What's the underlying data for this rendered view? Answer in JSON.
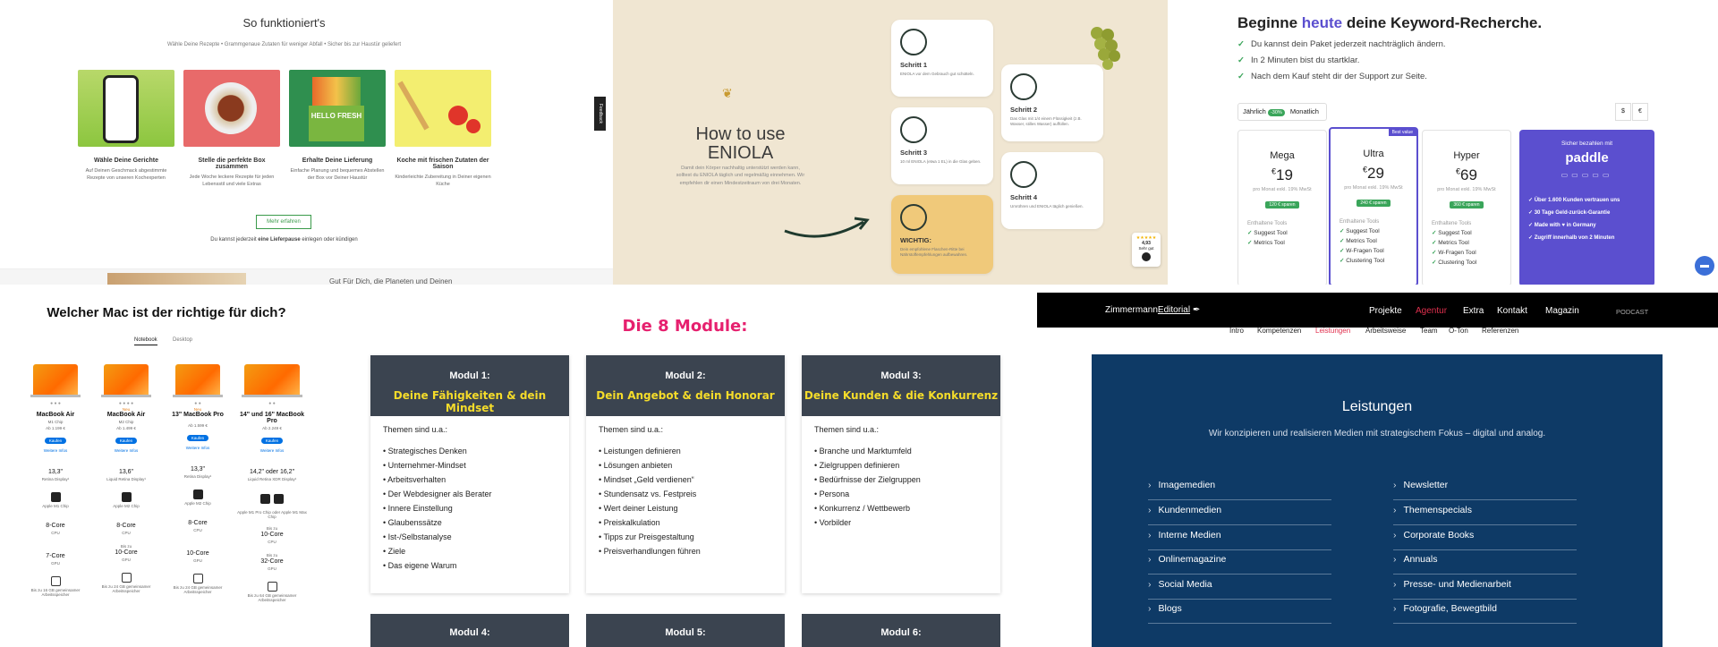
{
  "p1": {
    "title": "So funktioniert's",
    "subtitle": "Wähle Deine Rezepte • Grammgenaue Zutaten für weniger Abfall • Sicher bis zur Haustür geliefert",
    "steps": [
      {
        "title": "Wähle Deine Gerichte",
        "text": "Auf Deinen Geschmack abgestimmte Rezepte von unseren Kochexperten"
      },
      {
        "title": "Stelle die perfekte Box zusammen",
        "text": "Jede Woche leckere Rezepte für jeden Lebensstil und viele Extras"
      },
      {
        "title": "Erhalte Deine Lieferung",
        "text": "Einfache Planung und bequemes Abstellen der Box vor Deiner Haustür"
      },
      {
        "title": "Koche mit frischen Zutaten der Saison",
        "text": "Kinderleichte Zubereitung in Deiner eigenen Küche"
      }
    ],
    "hellofresh_logo": "HELLO FRESH",
    "more_button": "Mehr erfahren",
    "note_prefix": "Du kannst jederzeit ",
    "note_bold": "eine Lieferpause",
    "note_suffix": " einlegen oder kündigen",
    "feedback": "Feedback",
    "bottom_text": "Gut Für Dich, die Planeten und Deinen"
  },
  "p2": {
    "title_line1": "How to use",
    "title_line2": "ENIOLA",
    "description": "Damit dein Körper nachhaltig unterstützt werden kann, solltest du ENIOLA täglich und regelmäßig einnehmen. Wir empfehlen dir einen Mindestzeitraum von drei Monaten.",
    "steps": [
      {
        "title": "Schritt 1",
        "text": "ENIOLA vor dem Gebrauch gut schütteln."
      },
      {
        "title": "Schritt 2",
        "text": "Das Glas mit 1/4 einem Flüssigkeit (z.B. Wasser, stilles Wasser) auffüllen."
      },
      {
        "title": "Schritt 3",
        "text": "10 ml ENIOLA (etwa 1 EL) in die Glas geben."
      },
      {
        "title": "Schritt 4",
        "text": "Umrühren und ENIOLA täglich genießen."
      }
    ],
    "important_title": "WICHTIG:",
    "important_text": "Dein empfohlene Flaschen-Ritte bei Nährstoffempfehlungen aufbewahren.",
    "rating_stars": "★★★★★",
    "rating_value": "4,93",
    "rating_label": "Sehr gut"
  },
  "p3": {
    "headline_before": "Beginne ",
    "headline_accent": "heute",
    "headline_after": " deine Keyword-Recherche.",
    "accent_color": "#5b4fcf",
    "bullets": [
      "Du kannst dein Paket jederzeit nachträglich ändern.",
      "In 2 Minuten bist du startklar.",
      "Nach dem Kauf steht dir der Support zur Seite."
    ],
    "billing": {
      "yearly": "Jährlich",
      "discount": "-30%",
      "monthly": "Monatlich"
    },
    "currency": [
      "$",
      "€"
    ],
    "plans": [
      {
        "name": "Mega",
        "currency": "€",
        "price": "19",
        "note": "pro Monat exkl. 19% MwSt",
        "save": "120 € sparen",
        "tools": [
          "Suggest Tool",
          "Metrics Tool"
        ]
      },
      {
        "name": "Ultra",
        "currency": "€",
        "price": "29",
        "note": "pro Monat exkl. 19% MwSt",
        "save": "240 € sparen",
        "tools": [
          "Suggest Tool",
          "Metrics Tool",
          "W-Fragen Tool",
          "Clustering Tool"
        ],
        "badge": "Best value"
      },
      {
        "name": "Hyper",
        "currency": "€",
        "price": "69",
        "note": "pro Monat exkl. 19% MwSt",
        "save": "360 € sparen",
        "tools": [
          "Suggest Tool",
          "Metrics Tool",
          "W-Fragen Tool",
          "Clustering Tool"
        ]
      }
    ],
    "tools_label": "Enthaltene Tools",
    "paddle": {
      "label": "Sicher bezahlen mit",
      "brand": "paddle",
      "points": [
        "Über 1.600 Kunden vertrauen uns",
        "30 Tage Geld-zurück-Garantie",
        "Made with ♥ in Germany",
        "Zugriff innerhalb von 2 Minuten"
      ]
    }
  },
  "p4": {
    "title": "Welcher Mac ist der richtige für dich?",
    "tabs": [
      "Notebook",
      "Desktop"
    ],
    "models": [
      {
        "name": "MacBook Air",
        "chip": "M1 Chip",
        "price": "Ab 1.199 €",
        "buy": "Kaufen",
        "more": "Weitere Infos",
        "display": "13,3\"",
        "display_note": "Retina Display¹",
        "chip_name": "Apple M1 Chip",
        "cpu": "8-Core",
        "gpu": "7-Core",
        "memory": "Bis zu 16 GB gemeinsamer Arbeitsspeicher"
      },
      {
        "name": "MacBook Air",
        "chip": "M2 Chip",
        "badge": "Neu",
        "price": "Ab 1.499 €",
        "buy": "Kaufen",
        "more": "Weitere Infos",
        "display": "13,6\"",
        "display_note": "Liquid Retina Display¹",
        "chip_name": "Apple M2 Chip",
        "cpu": "8-Core",
        "gpu_prefix": "Bis zu",
        "gpu": "10-Core",
        "memory": "Bis zu 24 GB gemeinsamer Arbeitsspeicher"
      },
      {
        "name": "13\" MacBook Pro",
        "badge": "Neu",
        "price": "Ab 1.599 €",
        "buy": "Kaufen",
        "more": "Weitere Infos",
        "display": "13,3\"",
        "display_note": "Retina Display¹",
        "chip_name": "Apple M2 Chip",
        "cpu": "8-Core",
        "gpu": "10-Core",
        "memory": "Bis zu 24 GB gemeinsamer Arbeitsspeicher"
      },
      {
        "name": "14\" und 16\" MacBook Pro",
        "price": "Ab 2.249 €",
        "buy": "Kaufen",
        "more": "Weitere Infos",
        "display": "14,2\" oder 16,2\"",
        "display_note": "Liquid Retina XDR Display¹",
        "chip_name": "Apple M1 Pro Chip oder Apple M1 Max Chip",
        "cpu_prefix": "Bis zu",
        "cpu": "10-Core",
        "gpu_prefix": "Bis zu",
        "gpu": "32-Core",
        "memory": "Bis zu 64 GB gemeinsamer Arbeitsspeicher"
      }
    ],
    "cpu_label": "CPU",
    "gpu_label": "GPU"
  },
  "p5": {
    "title": "Die 8 Module:",
    "intro": "Themen sind u.a.:",
    "modules": [
      {
        "num": "Modul 1:",
        "title": "Deine Fähigkeiten & dein Mindset",
        "items": [
          "Strategisches Denken",
          "Unternehmer-Mindset",
          "Arbeitsverhalten",
          "Der Webdesigner als Berater",
          "Innere Einstellung",
          "Glaubenssätze",
          "Ist-/Selbstanalyse",
          "Ziele",
          "Das eigene Warum"
        ]
      },
      {
        "num": "Modul 2:",
        "title": "Dein Angebot & dein Honorar",
        "items": [
          "Leistungen definieren",
          "Lösungen anbieten",
          "Mindset „Geld verdienen“",
          "Stundensatz vs. Festpreis",
          "Wert deiner Leistung",
          "Preiskalkulation",
          "Tipps zur Preisgestaltung",
          "Preisverhandlungen führen"
        ]
      },
      {
        "num": "Modul 3:",
        "title": "Deine Kunden & die Konkurrenz",
        "items": [
          "Branche und Marktumfeld",
          "Zielgruppen definieren",
          "Bedürfnisse der Zielgruppen",
          "Persona",
          "Konkurrenz / Wettbewerb",
          "Vorbilder"
        ]
      }
    ],
    "next_modules": [
      "Modul 4:",
      "Modul 5:",
      "Modul 6:"
    ]
  },
  "p6": {
    "logo_main": "Zimmermann",
    "logo_accent": "Editorial",
    "nav": [
      "Projekte",
      "Agentur",
      "Extra",
      "Kontakt",
      "Magazin"
    ],
    "nav_active": "Agentur",
    "podcast": "PODCAST",
    "subnav": [
      "Intro",
      "Kompetenzen",
      "Leistungen",
      "Arbeitsweise",
      "Team",
      "O-Ton",
      "Referenzen"
    ],
    "subnav_active": "Leistungen",
    "active_color": "#e0304e",
    "title": "Leistungen",
    "lead": "Wir konzipieren und realisieren Medien mit strategischem Fokus – digital und analog.",
    "left": [
      "Imagemedien",
      "Kundenmedien",
      "Interne Medien",
      "Onlinemagazine",
      "Social Media",
      "Blogs"
    ],
    "right": [
      "Newsletter",
      "Themenspecials",
      "Corporate Books",
      "Annuals",
      "Presse- und Medienarbeit",
      "Fotografie, Bewegtbild"
    ]
  }
}
